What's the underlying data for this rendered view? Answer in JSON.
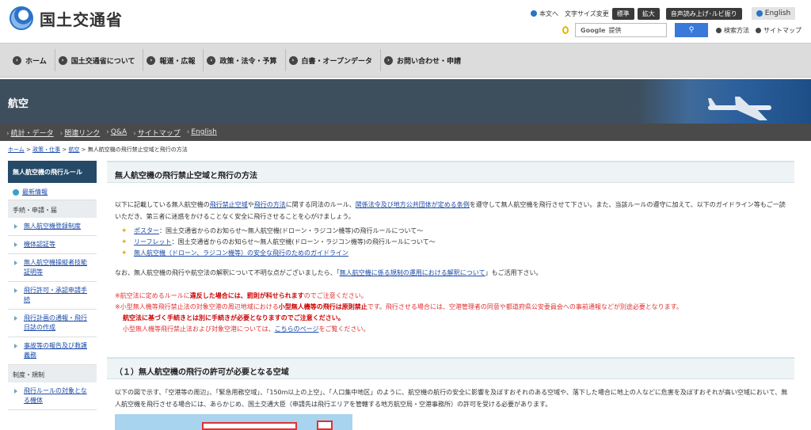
{
  "header": {
    "site_name": "国土交通省",
    "util": {
      "main_text": "本文へ",
      "text_size_label": "文字サイズ変更",
      "size_standard": "標準",
      "size_large": "拡大",
      "read_aloud": "音声読み上げ･ルビ振り",
      "english": "English"
    },
    "search": {
      "google_label": "Google",
      "provided": "提供",
      "search_method": "検索方法",
      "sitemap": "サイトマップ"
    }
  },
  "nav": {
    "items": [
      "ホーム",
      "国土交通省について",
      "報道・広報",
      "政策・法令・予算",
      "白書・オープンデータ",
      "お問い合わせ・申請"
    ]
  },
  "banner": {
    "title": "航空"
  },
  "subnav": {
    "items": [
      "統計・データ",
      "関連リンク",
      "Q&A",
      "サイトマップ",
      "English"
    ]
  },
  "breadcrumb": {
    "home": "ホーム",
    "work": "政策・仕事",
    "air": "航空",
    "current": "無人航空機の飛行禁止空域と飛行の方法"
  },
  "sidebar": {
    "title": "無人航空機の飛行ルール",
    "news": "最新情報",
    "group1": "手続・申請・届",
    "items1": [
      "無人航空機登録制度",
      "機体認証等",
      "無人航空機操縦者技能証明等",
      "飛行許可・承認申請手続",
      "飛行計画の通報・飛行日誌の作成",
      "事故等の報告及び救護義務"
    ],
    "group2": "制度・規制",
    "items2": [
      "飛行ルールの対象となる機体"
    ]
  },
  "main": {
    "title": "無人航空機の飛行禁止空域と飛行の方法",
    "intro_1": "以下に記載している無人航空機の",
    "intro_link1": "飛行禁止空域",
    "intro_2": "や",
    "intro_link2": "飛行の方法",
    "intro_3": "に関する同法のルール、",
    "intro_link3": "関係法令及び地方公共団体が定める条例",
    "intro_4": "を遵守して無人航空機を飛行させて下さい。また、当該ルールの遵守に加えて、以下のガイドライン等もご一読いただき、第三者に迷惑をかけることなく安全に飛行させることを心がけましょう。",
    "link_poster": "ポスター",
    "link_poster_desc": "：国土交通省からのお知らせ～無人航空機(ドローン・ラジコン機等)の飛行ルールについて～",
    "link_leaflet": "リーフレット",
    "link_leaflet_desc": "：国土交通省からのお知らせ～無人航空機(ドローン・ラジコン機等)の飛行ルールについて～",
    "link_guideline": "無人航空機（ドローン、ラジコン機等）の安全な飛行のためのガイドライン",
    "note_1": "なお、無人航空機の飛行や航空法の解釈について不明な点がございましたら、「",
    "note_link": "無人航空機に係る規制の運用における解釈について",
    "note_2": "」もご活用下さい。",
    "red1_a": "※航空法に定めるルールに",
    "red1_b": "違反した場合には、罰則が科せられます",
    "red1_c": "のでご注意ください。",
    "red2_a": "※小型無人機等飛行禁止法の対象空港の周辺地域における",
    "red2_b": "小型無人機等の飛行は原則禁止",
    "red2_c": "です。飛行させる場合には、空港管理者の同意や都道府県公安委員会への事前通報などが別途必要となります。",
    "red3": "航空法に基づく手続きとは別に手続きが必要となりますのでご注意ください。",
    "red4_a": "小型無人機等飛行禁止法および対象空港については、",
    "red4_link": "こちらのページ",
    "red4_b": "をご覧ください。",
    "section1_title": "（１）無人航空機の飛行の許可が必要となる空域",
    "section1_text": "以下の図で示す、「空港等の周辺」、「緊急用務空域」、「150m以上の上空」、「人口集中地区」のように、航空機の航行の安全に影響を及ぼすおそれのある空域や、落下した場合に地上の人などに危害を及ぼすおそれが高い空域において、無人航空機を飛行させる場合には、あらかじめ、国土交通大臣（申請先は飛行エリアを管轄する地方航空局・空港事務所）の許可を受ける必要があります。"
  }
}
